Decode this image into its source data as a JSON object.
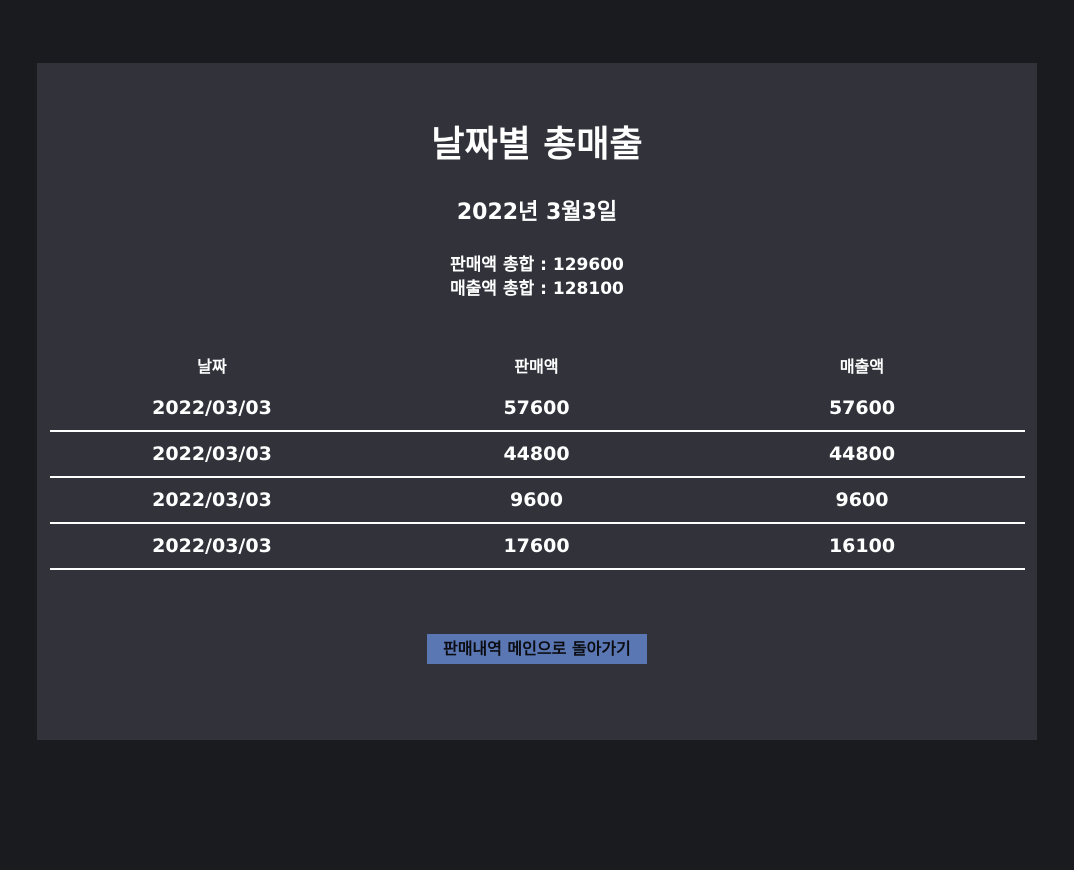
{
  "page": {
    "title": "날짜별 총매출",
    "date_heading": "2022년 3월3일"
  },
  "totals": {
    "sales_label": "판매액 총합 : 129600",
    "revenue_label": "매출액 총합 : 128100"
  },
  "table": {
    "headers": [
      "날짜",
      "판매액",
      "매출액"
    ],
    "rows": [
      [
        "2022/03/03",
        "57600",
        "57600"
      ],
      [
        "2022/03/03",
        "44800",
        "44800"
      ],
      [
        "2022/03/03",
        "9600",
        "9600"
      ],
      [
        "2022/03/03",
        "17600",
        "16100"
      ]
    ]
  },
  "actions": {
    "back_label": "판매내역 메인으로 돌아가기"
  },
  "colors": {
    "background": "#1a1b1f",
    "panel": "#31323a",
    "button": "#5a77b4",
    "text": "#ffffff"
  }
}
